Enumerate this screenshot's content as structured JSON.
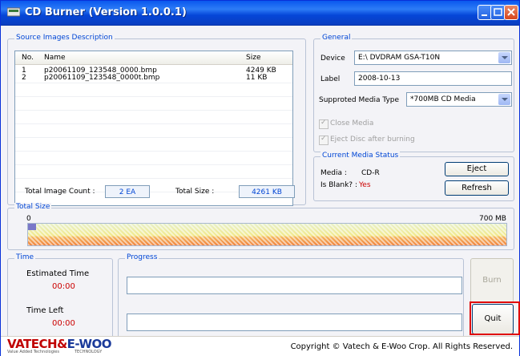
{
  "window": {
    "title": "CD Burner (Version 1.0.0.1)"
  },
  "source": {
    "group_label": "Source Images Description",
    "columns": {
      "no": "No.",
      "name": "Name",
      "size": "Size"
    },
    "rows": [
      {
        "no": "1",
        "name": "p20061109_123548_0000.bmp",
        "size": "4249 KB"
      },
      {
        "no": "2",
        "name": "p20061109_123548_0000t.bmp",
        "size": "11 KB"
      }
    ],
    "total_count_label": "Total Image Count :",
    "total_count_value": "2 EA",
    "total_size_label": "Total Size :",
    "total_size_value": "4261 KB"
  },
  "general": {
    "group_label": "General",
    "device_label": "Device",
    "device_value": "E:\\ DVDRAM GSA-T10N",
    "label_label": "Label",
    "label_value": "2008-10-13",
    "media_type_label": "Supproted Media Type",
    "media_type_value": "*700MB CD Media",
    "close_media_label": "Close Media",
    "eject_after_label": "Eject Disc after burning"
  },
  "status": {
    "group_label": "Current Media Status",
    "media_label": "Media :",
    "media_value": "CD-R",
    "blank_label": "Is Blank? :",
    "blank_value": "Yes",
    "eject_button": "Eject",
    "refresh_button": "Refresh"
  },
  "total_size": {
    "group_label": "Total Size",
    "min_label": "0",
    "max_label": "700 MB",
    "fill_fraction": 0.017
  },
  "time": {
    "group_label": "Time",
    "estimated_label": "Estimated Time",
    "estimated_value": "00:00",
    "left_label": "Time Left",
    "left_value": "00:00"
  },
  "progress": {
    "group_label": "Progress",
    "burn_button": "Burn",
    "quit_button": "Quit"
  },
  "footer": {
    "logo_part1": "VATECH",
    "logo_amp": "&",
    "logo_part2": "E-WOO",
    "logo_sub_left": "Value Added Technologies",
    "logo_sub_right": "TECHNOLOGY",
    "copyright": "Copyright © Vatech & E-Woo Crop. All Rights Reserved."
  },
  "colors": {
    "accent": "#0046d5",
    "alert": "#cc0000",
    "titlebar": "#0a58ee"
  }
}
